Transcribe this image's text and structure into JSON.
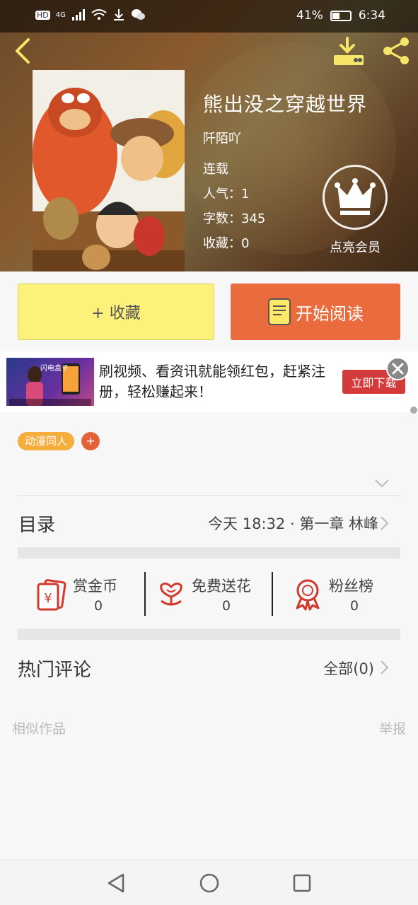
{
  "status_bar": {
    "left_badges": [
      "HD",
      "4G"
    ],
    "battery_percent": "41%",
    "battery_level": 0.41,
    "time": "6:34"
  },
  "header": {
    "icons": {
      "back": "back-arrow-icon",
      "download": "download-icon",
      "share": "share-icon"
    }
  },
  "book": {
    "title": "熊出没之穿越世界",
    "author": "阡陌吖",
    "status": "连载",
    "popularity": "人气：1",
    "word_count": "字数：345",
    "favorites": "收藏：0",
    "vip_label": "点亮会员"
  },
  "actions": {
    "favorite_label": "+ 收藏",
    "read_label": "开始阅读"
  },
  "ad": {
    "text": "刷视频、看资讯就能领红包，赶紧注册，轻松赚起来！",
    "button_label": "立即下载",
    "brand": "闪电盒子"
  },
  "tags": {
    "items": [
      "动漫同人"
    ],
    "add_label": "+"
  },
  "toc": {
    "title": "目录",
    "latest": "今天 18:32 · 第一章 林峰"
  },
  "stats": [
    {
      "label": "赏金币",
      "value": "0",
      "icon": "red-envelope-icon"
    },
    {
      "label": "免费送花",
      "value": "0",
      "icon": "flower-icon"
    },
    {
      "label": "粉丝榜",
      "value": "0",
      "icon": "medal-icon"
    }
  ],
  "comments": {
    "title": "热门评论",
    "all_label": "全部(0)"
  },
  "footer": {
    "similar": "相似作品",
    "report": "举报"
  },
  "colors": {
    "accent_orange": "#ea6b3e",
    "favorite_yellow": "#fcf17a",
    "tag_orange": "#f5ad3b",
    "icon_red": "#d0392b"
  }
}
